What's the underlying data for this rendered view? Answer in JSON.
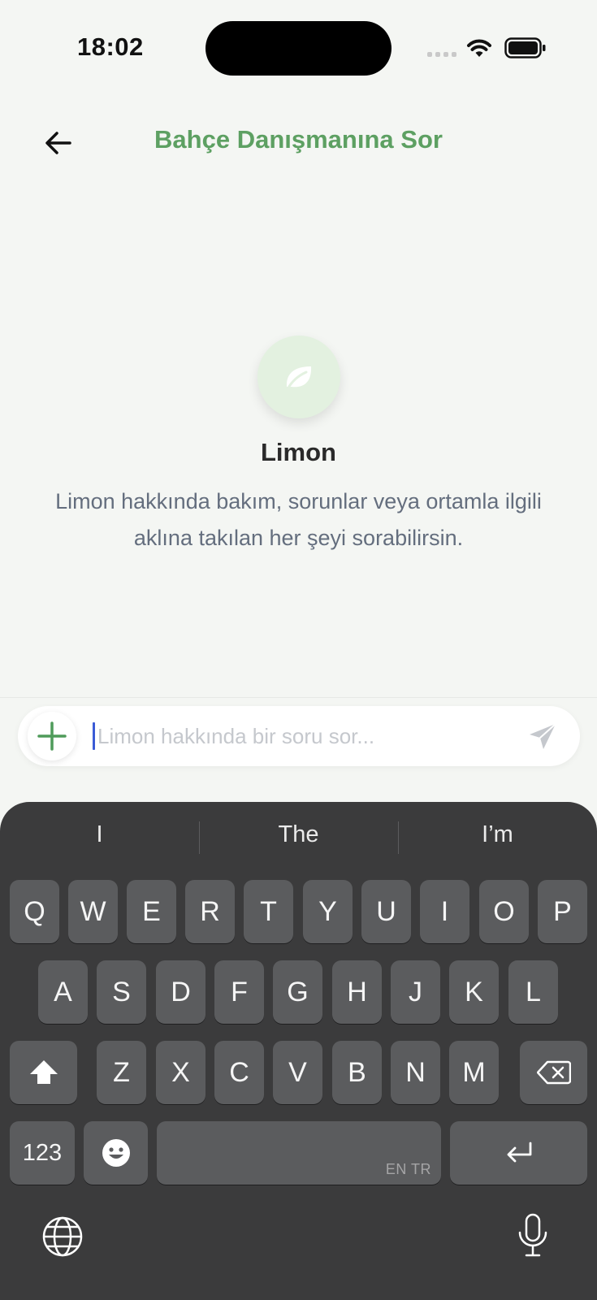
{
  "status_bar": {
    "time": "18:02"
  },
  "header": {
    "title": "Bahçe Danışmanına Sor",
    "back_icon": "arrow-left-icon"
  },
  "plant": {
    "icon": "leaf-icon",
    "name": "Limon",
    "description": "Limon hakkında bakım, sorunlar veya ortamla ilgili aklına takılan her şeyi sorabilirsin."
  },
  "composer": {
    "placeholder": "Limon hakkında bir soru sor...",
    "value": "",
    "add_icon": "plus-icon",
    "send_icon": "send-icon"
  },
  "keyboard": {
    "suggestions": [
      "I",
      "The",
      "I’m"
    ],
    "row1": [
      "Q",
      "W",
      "E",
      "R",
      "T",
      "Y",
      "U",
      "I",
      "O",
      "P"
    ],
    "row2": [
      "A",
      "S",
      "D",
      "F",
      "G",
      "H",
      "J",
      "K",
      "L"
    ],
    "row3": [
      "Z",
      "X",
      "C",
      "V",
      "B",
      "N",
      "M"
    ],
    "numbers_key": "123",
    "space_language": "EN TR"
  },
  "colors": {
    "accent": "#5da062",
    "background": "#f4f6f3",
    "keyboard": "#3b3b3c",
    "key": "#5b5c5e"
  }
}
